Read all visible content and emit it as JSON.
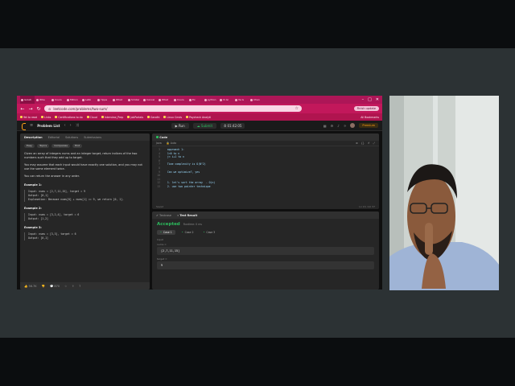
{
  "browser": {
    "tabs": [
      "Isolati",
      "Wha",
      "Cours",
      "Million",
      "LeRo",
      "Yippe",
      "What",
      "Similar",
      "Cancel",
      "What",
      "Cours",
      "Ex",
      "python",
      "Vi Gi",
      "Ve G",
      "Chan"
    ],
    "url": "leetcode.com/problems/two-sum/",
    "update_label": "Finish update",
    "bookmarks": [
      "Yet to read",
      "Links",
      "Certifications to do",
      "Cloud",
      "Interview_Prep",
      "JobPortals",
      "Gandhi",
      "Linux Cmds",
      "Paycheck Analyti"
    ],
    "bookmarks_right": "All Bookmarks"
  },
  "leetcode": {
    "problem_list": "Problem List",
    "run": "Run",
    "submit": "Submit",
    "timer": "01:42:05",
    "premium": "Premium",
    "desc_tabs": [
      "Description",
      "Editorial",
      "Solutions",
      "Submissions"
    ],
    "chips": [
      "Easy",
      "Topics",
      "Companies",
      "Hint"
    ],
    "paragraph_1": "Given an array of integers nums and an integer target, return indices of the two numbers such that they add up to target.",
    "paragraph_2": "You may assume that each input would have exactly one solution, and you may not use the same element twice.",
    "paragraph_3": "You can return the answer in any order.",
    "examples": [
      {
        "title": "Example 1:",
        "input": "Input: nums = [2,7,11,15], target = 9",
        "output": "Output: [0,1]",
        "explanation": "Explanation: Because nums[0] + nums[1] == 9, we return [0, 1]."
      },
      {
        "title": "Example 2:",
        "input": "Input: nums = [3,2,4], target = 6",
        "output": "Output: [1,2]"
      },
      {
        "title": "Example 3:",
        "input": "Input: nums = [3,3], target = 6",
        "output": "Output: [0,1]"
      }
    ],
    "desc_footer": {
      "likes": "56.7K",
      "comments": "870"
    },
    "code_tab": "Code",
    "language": "Java",
    "autosave": "Auto",
    "code_lines": [
      "  approach 1:",
      "  1<0 to n",
      "  j< i+1 to n",
      "",
      "  Time complexity is O(N^2)",
      "",
      "  Can we optimize?, yes",
      "",
      "",
      "  1. let's sort the array  - O(n)",
      "  2. use two pointer technique"
    ],
    "code_line_start": 3,
    "code_footer_left": "Saved",
    "code_footer_right": "Ln 13, Col 37",
    "test_tabs": [
      "Testcase",
      "Test Result"
    ],
    "accepted": "Accepted",
    "runtime": "Runtime: 0 ms",
    "cases": [
      "Case 1",
      "Case 2",
      "Case 3"
    ],
    "input_label": "Input",
    "nums_label": "nums =",
    "nums_value": "[2,7,11,15]",
    "target_label": "target =",
    "target_value": "9"
  }
}
